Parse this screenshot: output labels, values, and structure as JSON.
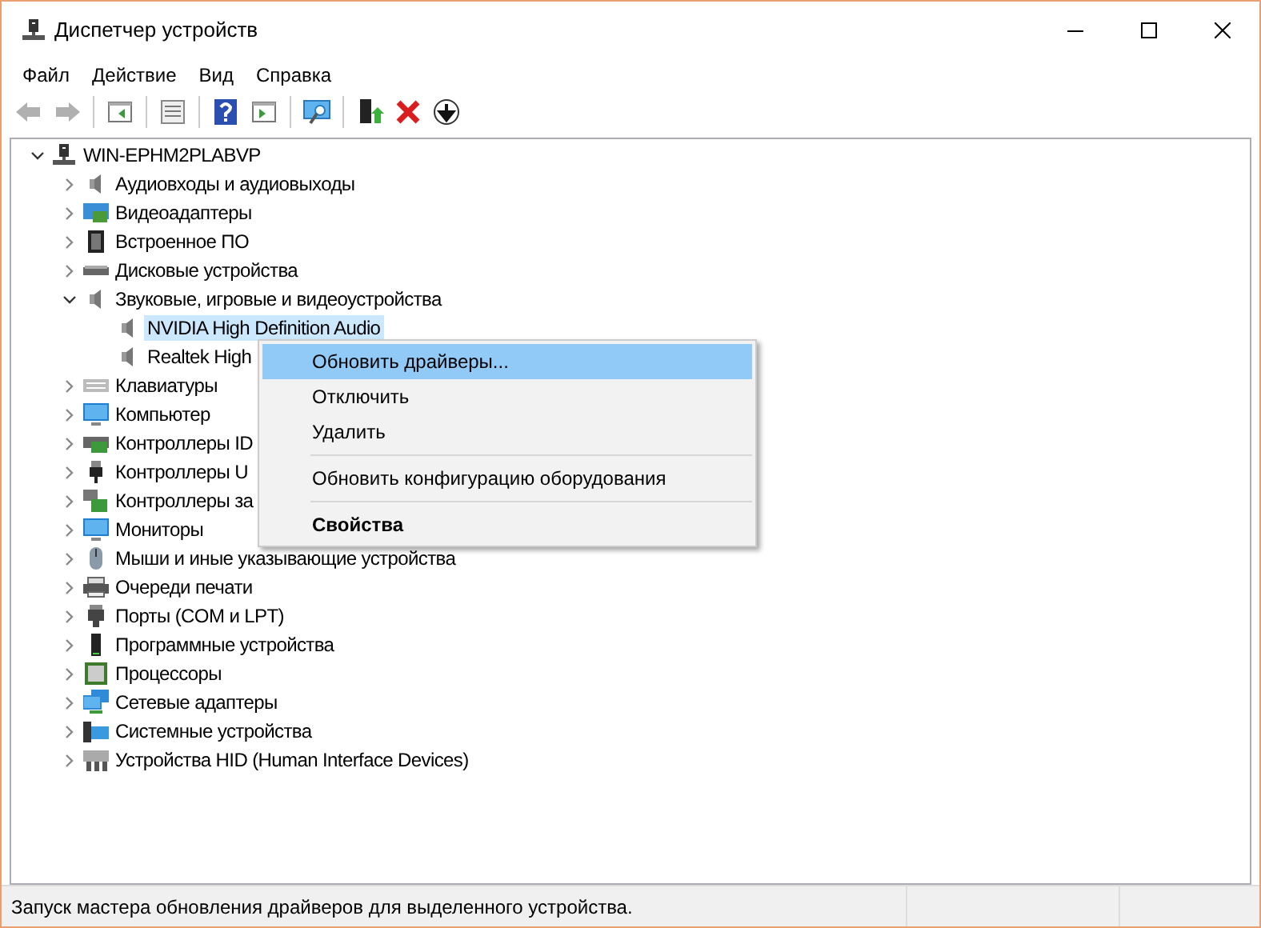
{
  "window": {
    "title": "Диспетчер устройств"
  },
  "menu": [
    "Файл",
    "Действие",
    "Вид",
    "Справка"
  ],
  "toolbar": [
    {
      "kind": "back",
      "disabled": true
    },
    {
      "kind": "forward",
      "disabled": true
    },
    {
      "kind": "separator"
    },
    {
      "kind": "pane",
      "disabled": false
    },
    {
      "kind": "separator"
    },
    {
      "kind": "properties",
      "disabled": false
    },
    {
      "kind": "separator"
    },
    {
      "kind": "help",
      "disabled": false
    },
    {
      "kind": "pane2",
      "disabled": false
    },
    {
      "kind": "separator"
    },
    {
      "kind": "scan",
      "disabled": false
    },
    {
      "kind": "separator"
    },
    {
      "kind": "update",
      "disabled": false
    },
    {
      "kind": "remove",
      "disabled": false
    },
    {
      "kind": "download",
      "disabled": false
    }
  ],
  "tree": [
    {
      "label": "WIN-EPHM2PLABVP",
      "kind": "computer",
      "expanded": true,
      "selected": false,
      "children": [
        {
          "label": "Аудиовходы и аудиовыходы",
          "kind": "speaker",
          "expanded": false,
          "selected": false
        },
        {
          "label": "Видеоадаптеры",
          "kind": "display",
          "expanded": false,
          "selected": false
        },
        {
          "label": "Встроенное ПО",
          "kind": "chip",
          "expanded": false,
          "selected": false
        },
        {
          "label": "Дисковые устройства",
          "kind": "disk",
          "expanded": false,
          "selected": false
        },
        {
          "label": "Звуковые, игровые и видеоустройства",
          "kind": "speaker",
          "expanded": true,
          "selected": false,
          "children": [
            {
              "label": "NVIDIA High Definition Audio",
              "kind": "speaker",
              "selected": true
            },
            {
              "label": "Realtek High",
              "kind": "speaker",
              "selected": false
            }
          ]
        },
        {
          "label": "Клавиатуры",
          "kind": "keyboard",
          "expanded": false,
          "selected": false
        },
        {
          "label": "Компьютер",
          "kind": "monitor",
          "expanded": false,
          "selected": false
        },
        {
          "label": "Контроллеры ID",
          "kind": "controller",
          "expanded": false,
          "selected": false
        },
        {
          "label": "Контроллеры U",
          "kind": "usb",
          "expanded": false,
          "selected": false
        },
        {
          "label": "Контроллеры за",
          "kind": "storage",
          "expanded": false,
          "selected": false
        },
        {
          "label": "Мониторы",
          "kind": "monitor",
          "expanded": false,
          "selected": false
        },
        {
          "label": "Мыши и иные указывающие устройства",
          "kind": "mouse",
          "expanded": false,
          "selected": false
        },
        {
          "label": "Очереди печати",
          "kind": "printer",
          "expanded": false,
          "selected": false
        },
        {
          "label": "Порты (COM и LPT)",
          "kind": "port",
          "expanded": false,
          "selected": false
        },
        {
          "label": "Программные устройства",
          "kind": "device",
          "expanded": false,
          "selected": false
        },
        {
          "label": "Процессоры",
          "kind": "cpu",
          "expanded": false,
          "selected": false
        },
        {
          "label": "Сетевые адаптеры",
          "kind": "network",
          "expanded": false,
          "selected": false
        },
        {
          "label": "Системные устройства",
          "kind": "system",
          "expanded": false,
          "selected": false
        },
        {
          "label": "Устройства HID (Human Interface Devices)",
          "kind": "hid",
          "expanded": false,
          "selected": false
        }
      ]
    }
  ],
  "context_menu": [
    {
      "kind": "item",
      "label": "Обновить драйверы...",
      "selected": true,
      "bold": false
    },
    {
      "kind": "item",
      "label": "Отключить",
      "selected": false,
      "bold": false
    },
    {
      "kind": "item",
      "label": "Удалить",
      "selected": false,
      "bold": false
    },
    {
      "kind": "separator"
    },
    {
      "kind": "item",
      "label": "Обновить конфигурацию оборудования",
      "selected": false,
      "bold": false
    },
    {
      "kind": "separator"
    },
    {
      "kind": "item",
      "label": "Свойства",
      "selected": false,
      "bold": true
    }
  ],
  "status_bar": {
    "text": "Запуск мастера обновления драйверов для выделенного устройства."
  }
}
